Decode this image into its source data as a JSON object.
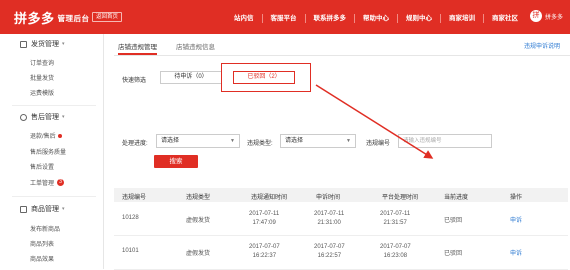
{
  "header": {
    "logo": "拼多多",
    "logo_sub": "管理后台",
    "back_button": "返回首页",
    "nav": [
      "站内信",
      "客服平台",
      "联系拼多多",
      "帮助中心",
      "规则中心",
      "商家培训",
      "商家社区"
    ],
    "avatar_char": "拼",
    "username": "拼多多"
  },
  "sidebar": {
    "sections": [
      {
        "title": "发货管理",
        "items": [
          "订单查询",
          "批量发货",
          "运费模版"
        ]
      },
      {
        "title": "售后管理",
        "items": [
          "退款/售后",
          "售后服务质量",
          "售后设置",
          "工单管理"
        ]
      },
      {
        "title": "商品管理",
        "items": [
          "发布新商品",
          "商品列表",
          "商品效果"
        ]
      }
    ],
    "workorder_badge": "3"
  },
  "main": {
    "tabs": [
      "店铺违规管理",
      "店铺违规信息"
    ],
    "help_link": "违规申诉说明",
    "quick_filter_label": "快速筛选",
    "quick_filters": [
      "待申诉（0）",
      "已驳回（2）"
    ],
    "filters": {
      "progress_label": "处理进度:",
      "progress_value": "请选择",
      "type_label": "违规类型:",
      "type_value": "请选择",
      "id_label": "违规编号",
      "id_placeholder": "请输入违规编号"
    },
    "search_button": "搜索",
    "table": {
      "headers": [
        "违规编号",
        "违规类型",
        "违规通知时间",
        "申诉时间",
        "平台处理时间",
        "当前进度",
        "操作"
      ],
      "rows": [
        {
          "id": "10128",
          "type": "虚假发货",
          "notify": [
            "2017-07-11",
            "17:47:09"
          ],
          "appeal": [
            "2017-07-11",
            "21:31:00"
          ],
          "handled": [
            "2017-07-11",
            "21:31:57"
          ],
          "status": "已驳回",
          "action": "申诉"
        },
        {
          "id": "10101",
          "type": "虚假发货",
          "notify": [
            "2017-07-07",
            "16:22:37"
          ],
          "appeal": [
            "2017-07-07",
            "16:22:57"
          ],
          "handled": [
            "2017-07-07",
            "16:23:08"
          ],
          "status": "已驳回",
          "action": "申诉"
        }
      ]
    }
  },
  "colors": {
    "brand": "#e02e24",
    "link": "#2d7ad2"
  }
}
